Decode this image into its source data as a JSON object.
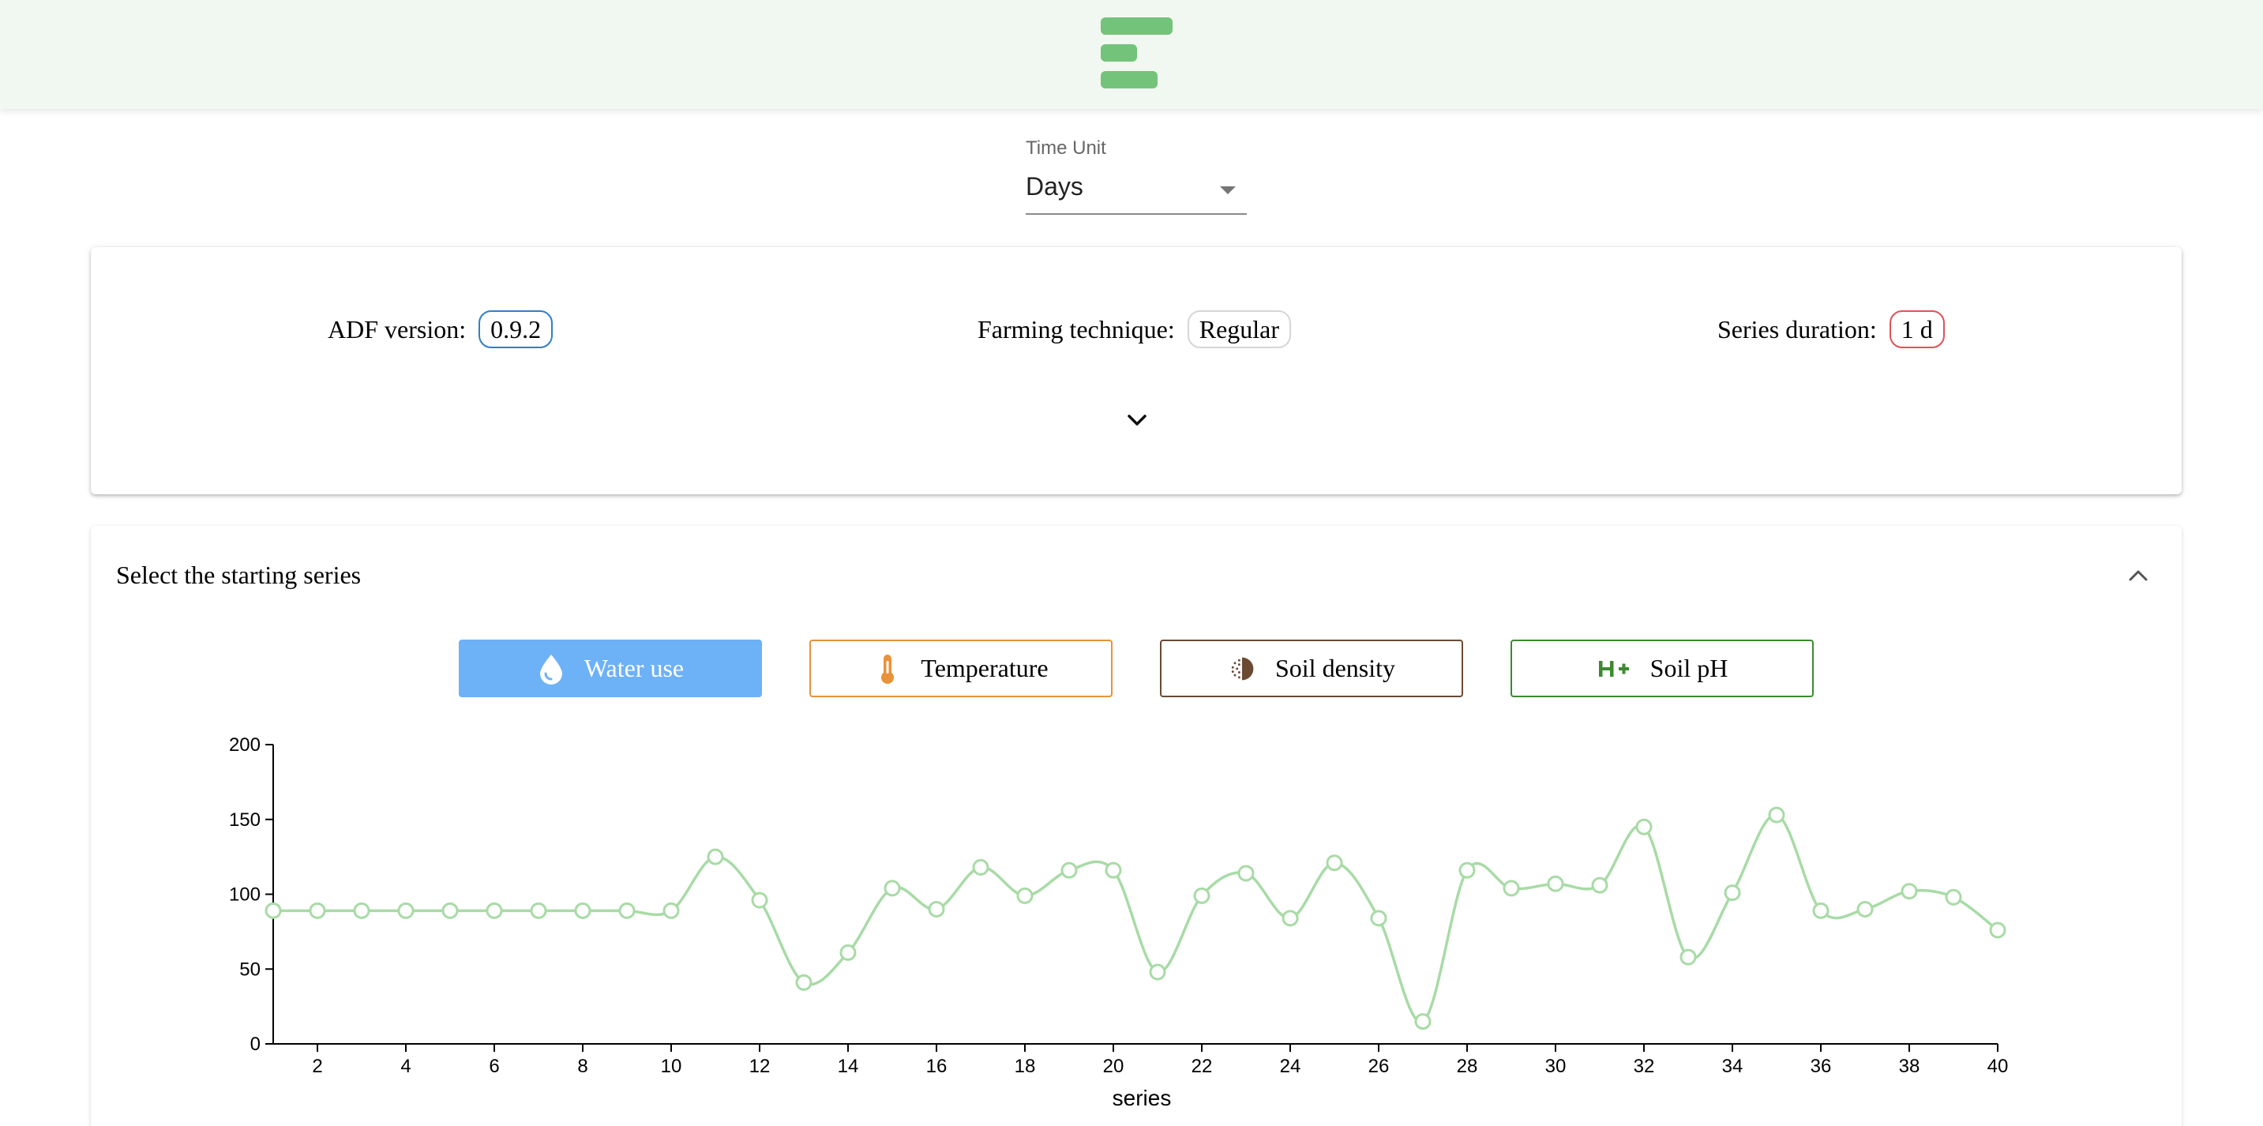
{
  "time_unit": {
    "label": "Time Unit",
    "value": "Days"
  },
  "info": {
    "adf_version_label": "ADF version:",
    "adf_version_value": "0.9.2",
    "farming_technique_label": "Farming technique:",
    "farming_technique_value": "Regular",
    "series_duration_label": "Series duration:",
    "series_duration_value": "1 d",
    "expand_icon": "chevron-down-icon"
  },
  "series_section": {
    "title": "Select the starting series",
    "collapse_icon": "chevron-up-icon",
    "buttons": [
      {
        "label": "Water use",
        "icon": "water-drop-icon",
        "color": "#6db1f7",
        "selected": true
      },
      {
        "label": "Temperature",
        "icon": "thermometer-icon",
        "color": "#e8923a",
        "selected": false
      },
      {
        "label": "Soil density",
        "icon": "soil-density-icon",
        "color": "#6b4a32",
        "selected": false
      },
      {
        "label": "Soil pH",
        "icon": "ph-icon",
        "color": "#3b8a2f",
        "selected": false
      }
    ]
  },
  "colors": {
    "header_bg": "#f1f8f1",
    "logo": "#74c37a",
    "line": "#a8dba6"
  },
  "chart_data": {
    "type": "line",
    "xlabel": "series",
    "ylabel": "",
    "x": [
      1,
      2,
      3,
      4,
      5,
      6,
      7,
      8,
      9,
      10,
      11,
      12,
      13,
      14,
      15,
      16,
      17,
      18,
      19,
      20,
      21,
      22,
      23,
      24,
      25,
      26,
      27,
      28,
      29,
      30,
      31,
      32,
      33,
      34,
      35,
      36,
      37,
      38,
      39,
      40
    ],
    "values": [
      89,
      89,
      89,
      89,
      89,
      89,
      89,
      89,
      89,
      89,
      125,
      96,
      41,
      61,
      104,
      90,
      118,
      99,
      116,
      116,
      48,
      99,
      114,
      84,
      121,
      84,
      15,
      116,
      104,
      107,
      106,
      145,
      58,
      101,
      153,
      89,
      90,
      102,
      98,
      76
    ],
    "xlim": [
      1,
      40
    ],
    "ylim": [
      0,
      200
    ],
    "xticks": [
      2,
      4,
      6,
      8,
      10,
      12,
      14,
      16,
      18,
      20,
      22,
      24,
      26,
      28,
      30,
      32,
      34,
      36,
      38,
      40
    ],
    "yticks": [
      0,
      50,
      100,
      150,
      200
    ],
    "grid": false,
    "legend": "none"
  }
}
